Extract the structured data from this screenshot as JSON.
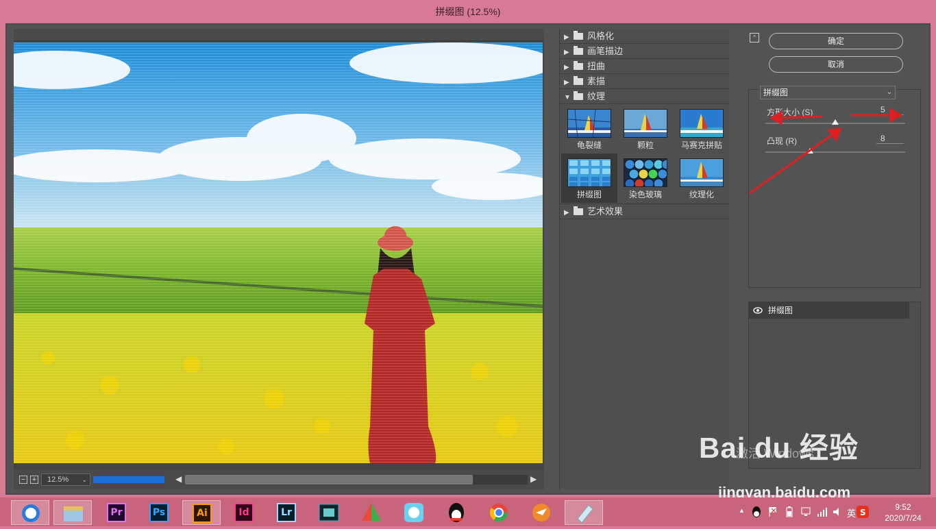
{
  "window": {
    "title": "拼缀图 (12.5%)"
  },
  "preview": {
    "zoom": "12.5%",
    "zoom_out": "−",
    "zoom_in": "+"
  },
  "filter_gallery": {
    "categories_top": [
      "风格化",
      "画笔描边",
      "扭曲",
      "素描"
    ],
    "open_category": "纹理",
    "thumbnails": [
      {
        "label": "龟裂缝"
      },
      {
        "label": "颗粒"
      },
      {
        "label": "马赛克拼贴"
      },
      {
        "label": "拼缀图"
      },
      {
        "label": "染色玻璃"
      },
      {
        "label": "纹理化"
      }
    ],
    "categories_bottom": [
      "艺术效果"
    ]
  },
  "actions": {
    "ok_label": "确定",
    "cancel_label": "取消"
  },
  "settings": {
    "filter_select": "拼缀图",
    "params": [
      {
        "label": "方形大小 (S)",
        "value": "5",
        "level": 0.5
      },
      {
        "label": "凸现 (R)",
        "value": "8",
        "level": 0.32
      }
    ]
  },
  "layers": {
    "items": [
      {
        "name": "拼缀图"
      }
    ]
  },
  "watermark": {
    "activate": "激活 Windows",
    "baidu": "Bai du 经验",
    "url": "jingyan.baidu.com"
  },
  "taskbar": {
    "apps": [
      "Pr",
      "Ps",
      "Ai",
      "Id",
      "Lr"
    ],
    "ime": "英",
    "time": "9:52",
    "date": "2020/7/24"
  },
  "colors": {
    "accent_arrow": "#e02020",
    "progress": "#1c6fd6",
    "taskbar": "#c9647d"
  }
}
